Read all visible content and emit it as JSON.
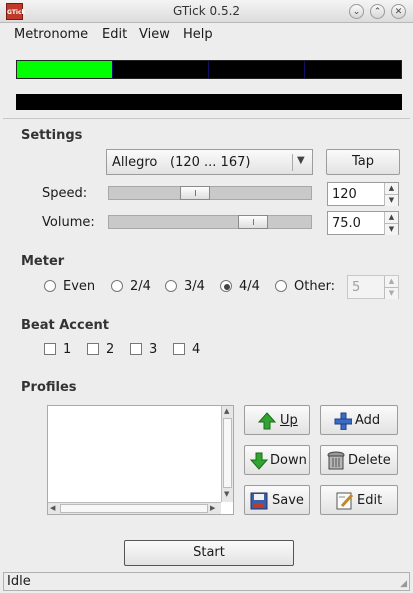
{
  "window": {
    "title": "GTick 0.5.2",
    "app_icon_text": "GTick"
  },
  "menubar": {
    "items": [
      "Metronome",
      "Edit",
      "View",
      "Help"
    ]
  },
  "beat_display": {
    "segments": 4,
    "active_segment": 1,
    "active_color": "#00ff00",
    "idle_color": "#000000"
  },
  "settings": {
    "heading": "Settings",
    "tempo_combo": {
      "name": "Allegro",
      "range": "(120 ... 167)"
    },
    "tap_label": "Tap",
    "speed_label": "Speed:",
    "speed_value": "120",
    "speed_slider_level": 0.42,
    "volume_label": "Volume:",
    "volume_value": "75.0",
    "volume_slider_level": 0.75
  },
  "meter": {
    "heading": "Meter",
    "options": [
      "Even",
      "2/4",
      "3/4",
      "4/4",
      "Other:"
    ],
    "selected": "4/4",
    "other_value": "5"
  },
  "beat_accent": {
    "heading": "Beat Accent",
    "items": [
      "1",
      "2",
      "3",
      "4"
    ]
  },
  "profiles": {
    "heading": "Profiles",
    "up_label": "Up",
    "add_label": "Add",
    "down_label": "Down",
    "delete_label": "Delete",
    "save_label": "Save",
    "edit_label": "Edit"
  },
  "start_label": "Start",
  "status_text": "Idle",
  "colors": {
    "accent_green": "#2fa52f",
    "add_blue": "#3b6cc4"
  }
}
